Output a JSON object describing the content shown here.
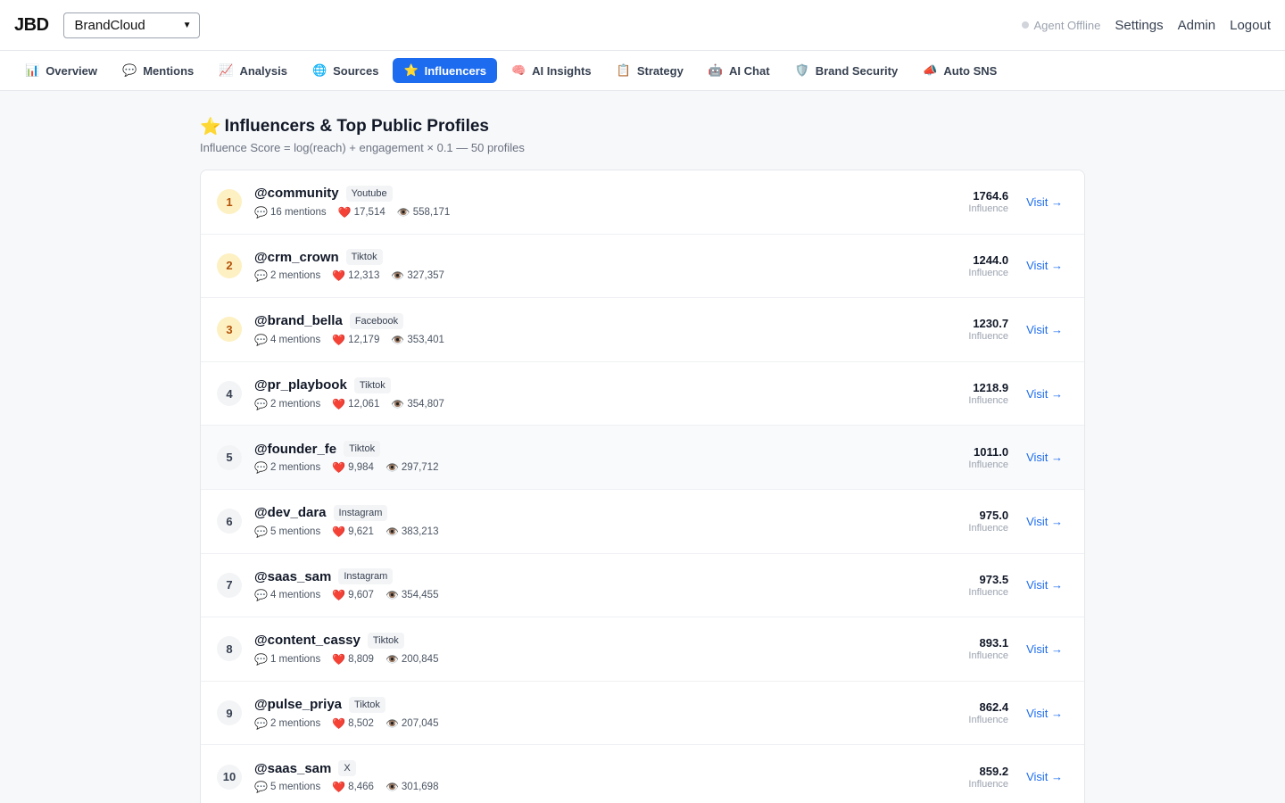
{
  "app": {
    "logo": "JBD",
    "brand_select": "BrandCloud",
    "agent_status": "Agent Offline",
    "links": {
      "settings": "Settings",
      "admin": "Admin",
      "logout": "Logout"
    }
  },
  "nav": [
    {
      "icon": "📊",
      "label": "Overview"
    },
    {
      "icon": "💬",
      "label": "Mentions"
    },
    {
      "icon": "📈",
      "label": "Analysis"
    },
    {
      "icon": "🌐",
      "label": "Sources"
    },
    {
      "icon": "⭐",
      "label": "Influencers",
      "active": true
    },
    {
      "icon": "🧠",
      "label": "AI Insights"
    },
    {
      "icon": "📋",
      "label": "Strategy"
    },
    {
      "icon": "🤖",
      "label": "AI Chat"
    },
    {
      "icon": "🛡️",
      "label": "Brand Security"
    },
    {
      "icon": "📣",
      "label": "Auto SNS"
    }
  ],
  "page": {
    "title_icon": "⭐",
    "title": "Influencers & Top Public Profiles",
    "subtitle": "Influence Score = log(reach) + engagement × 0.1 — 50 profiles",
    "score_label": "Influence",
    "visit_label": "Visit →",
    "stat_icons": {
      "mentions": "💬",
      "likes": "❤️",
      "views": "👁️"
    }
  },
  "influencers": [
    {
      "rank": "1",
      "handle": "@community",
      "platform": "Youtube",
      "mentions": "16 mentions",
      "likes": "17,514",
      "views": "558,171",
      "score": "1764.6"
    },
    {
      "rank": "2",
      "handle": "@crm_crown",
      "platform": "Tiktok",
      "mentions": "2 mentions",
      "likes": "12,313",
      "views": "327,357",
      "score": "1244.0"
    },
    {
      "rank": "3",
      "handle": "@brand_bella",
      "platform": "Facebook",
      "mentions": "4 mentions",
      "likes": "12,179",
      "views": "353,401",
      "score": "1230.7"
    },
    {
      "rank": "4",
      "handle": "@pr_playbook",
      "platform": "Tiktok",
      "mentions": "2 mentions",
      "likes": "12,061",
      "views": "354,807",
      "score": "1218.9"
    },
    {
      "rank": "5",
      "handle": "@founder_fe",
      "platform": "Tiktok",
      "mentions": "2 mentions",
      "likes": "9,984",
      "views": "297,712",
      "score": "1011.0"
    },
    {
      "rank": "6",
      "handle": "@dev_dara",
      "platform": "Instagram",
      "mentions": "5 mentions",
      "likes": "9,621",
      "views": "383,213",
      "score": "975.0"
    },
    {
      "rank": "7",
      "handle": "@saas_sam",
      "platform": "Instagram",
      "mentions": "4 mentions",
      "likes": "9,607",
      "views": "354,455",
      "score": "973.5"
    },
    {
      "rank": "8",
      "handle": "@content_cassy",
      "platform": "Tiktok",
      "mentions": "1 mentions",
      "likes": "8,809",
      "views": "200,845",
      "score": "893.1"
    },
    {
      "rank": "9",
      "handle": "@pulse_priya",
      "platform": "Tiktok",
      "mentions": "2 mentions",
      "likes": "8,502",
      "views": "207,045",
      "score": "862.4"
    },
    {
      "rank": "10",
      "handle": "@saas_sam",
      "platform": "X",
      "mentions": "5 mentions",
      "likes": "8,466",
      "views": "301,698",
      "score": "859.2"
    }
  ]
}
